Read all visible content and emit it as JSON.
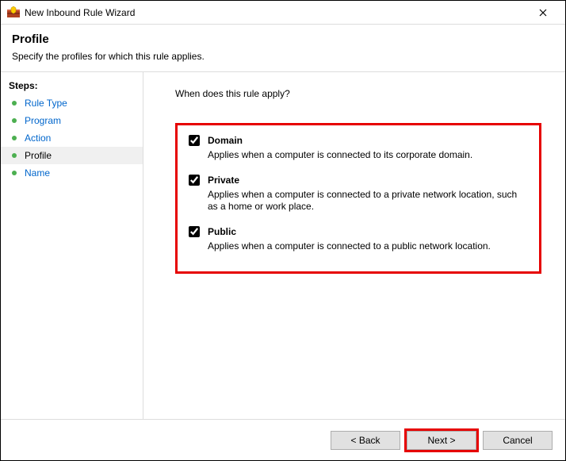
{
  "window": {
    "title": "New Inbound Rule Wizard"
  },
  "header": {
    "title": "Profile",
    "subtitle": "Specify the profiles for which this rule applies."
  },
  "steps": {
    "label": "Steps:",
    "items": [
      {
        "label": "Rule Type",
        "state": "done"
      },
      {
        "label": "Program",
        "state": "done"
      },
      {
        "label": "Action",
        "state": "done"
      },
      {
        "label": "Profile",
        "state": "current"
      },
      {
        "label": "Name",
        "state": "pending"
      }
    ]
  },
  "content": {
    "question": "When does this rule apply?",
    "profiles": [
      {
        "key": "domain",
        "label": "Domain",
        "checked": true,
        "desc": "Applies when a computer is connected to its corporate domain."
      },
      {
        "key": "private",
        "label": "Private",
        "checked": true,
        "desc": "Applies when a computer is connected to a private network location, such as a home or work place."
      },
      {
        "key": "public",
        "label": "Public",
        "checked": true,
        "desc": "Applies when a computer is connected to a public network location."
      }
    ]
  },
  "footer": {
    "back": "< Back",
    "next": "Next >",
    "cancel": "Cancel"
  }
}
